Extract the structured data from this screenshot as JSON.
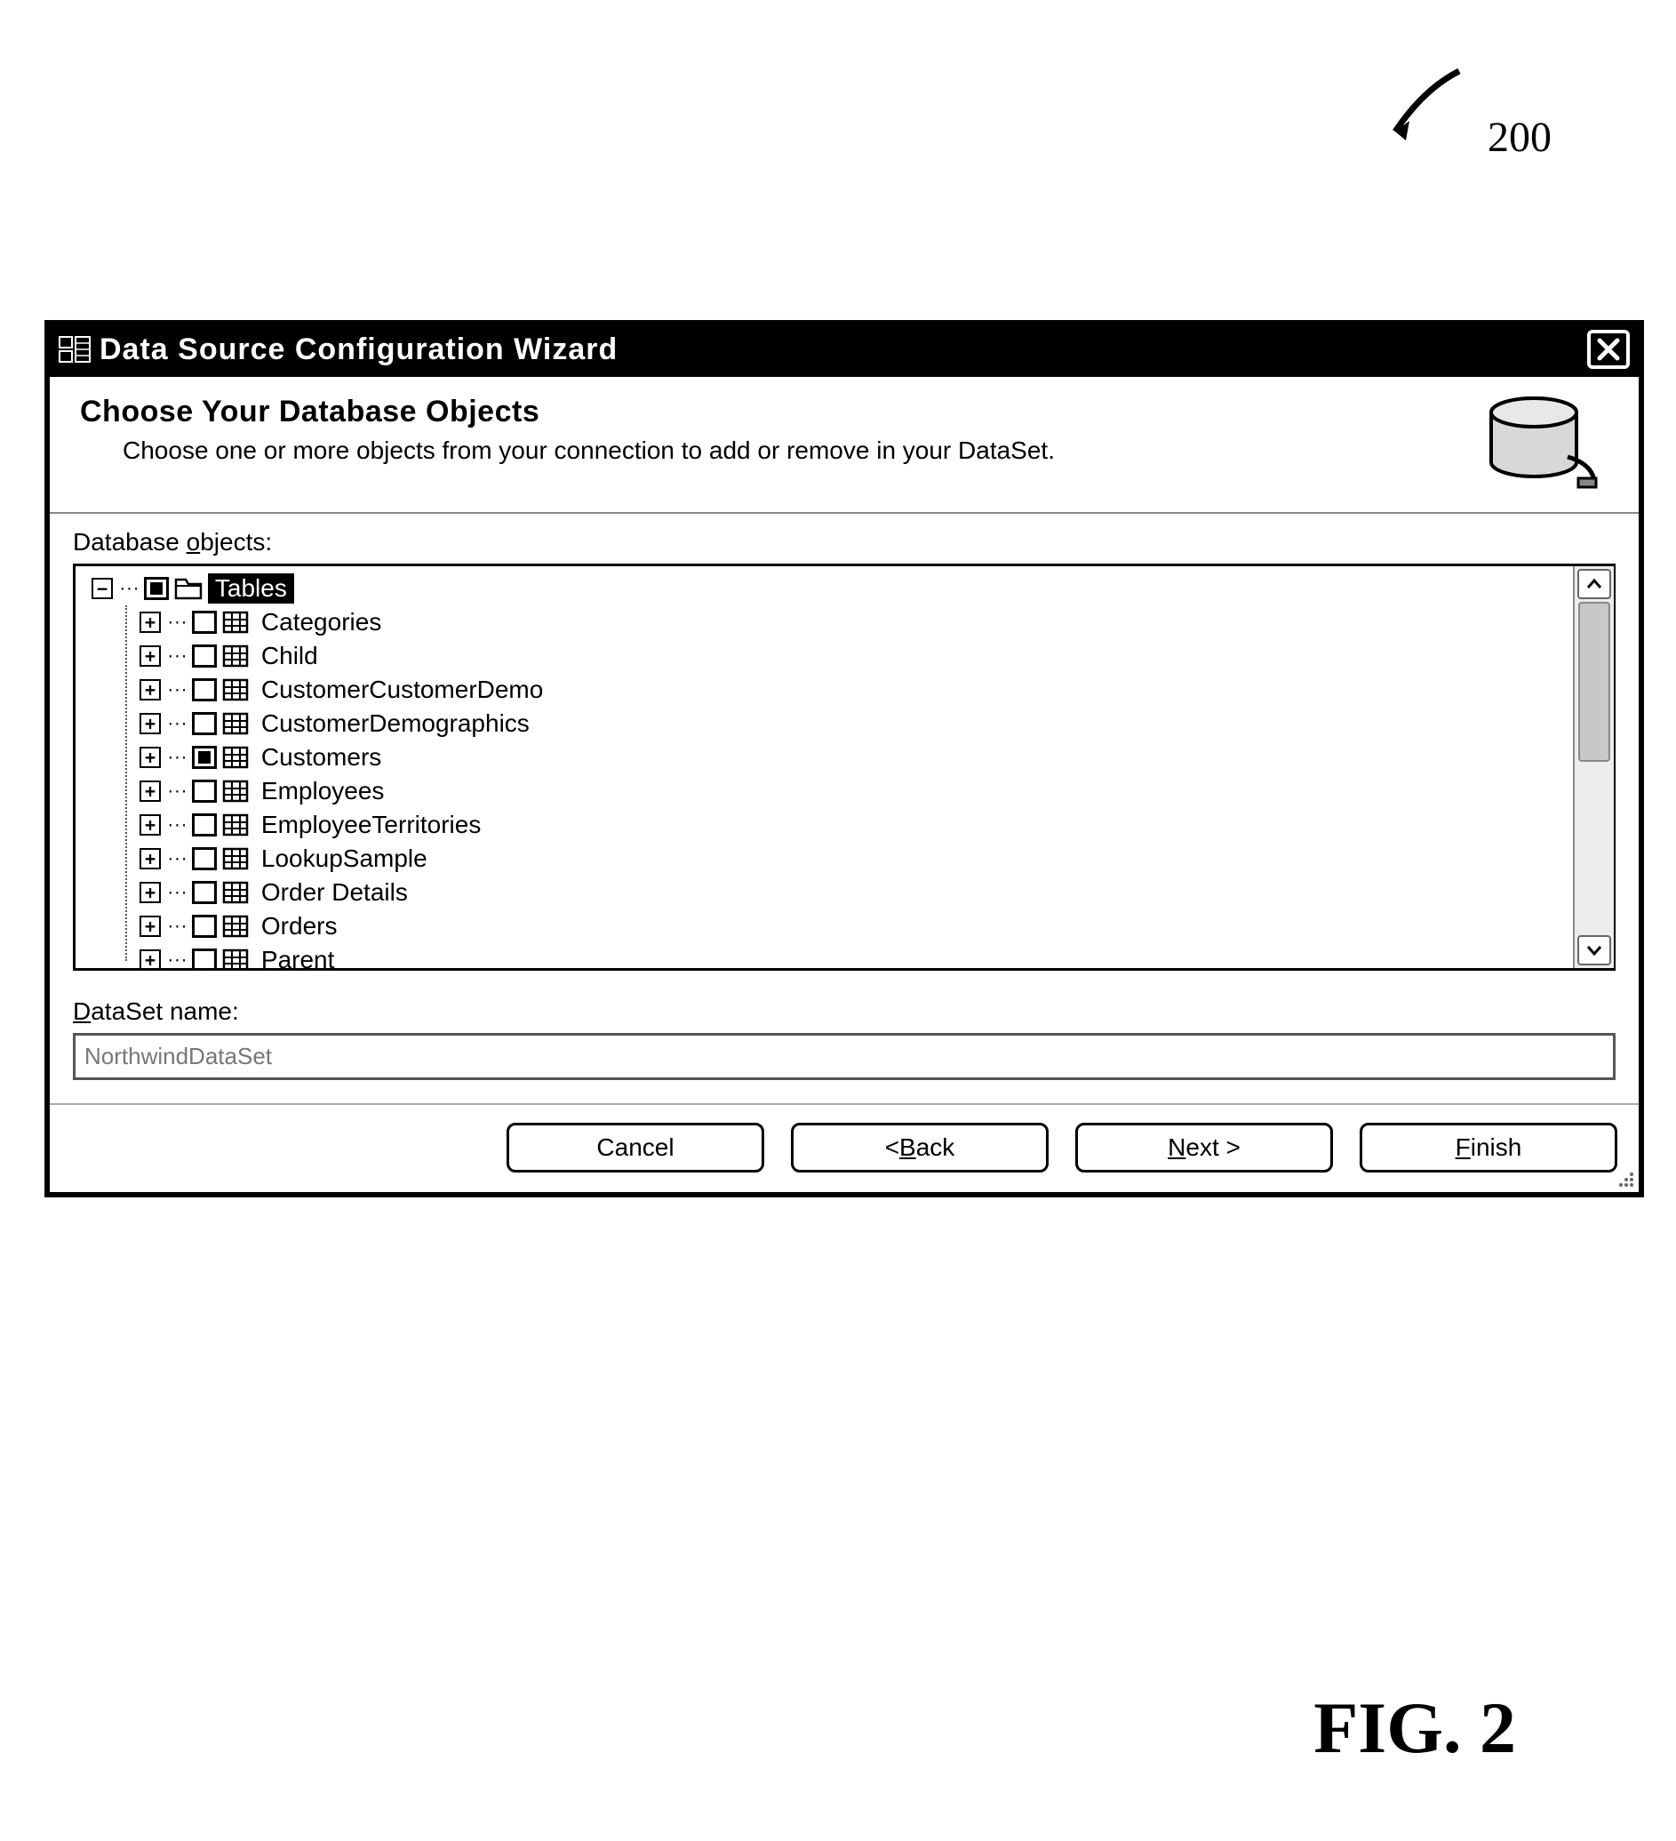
{
  "figure": {
    "top_label": "200",
    "bottom_label": "FIG. 2"
  },
  "window": {
    "title": "Data Source Configuration Wizard"
  },
  "header": {
    "title": "Choose Your Database Objects",
    "subtitle": "Choose one or more objects from your connection to add or remove in your DataSet."
  },
  "tree": {
    "label_prefix": "Database ",
    "label_underline": "o",
    "label_suffix": "bjects:",
    "root": {
      "label": "Tables",
      "expanded": true,
      "checked": "partial",
      "selected": true
    },
    "items": [
      {
        "label": "Categories",
        "checked": false
      },
      {
        "label": "Child",
        "checked": false
      },
      {
        "label": "CustomerCustomerDemo",
        "checked": false
      },
      {
        "label": "CustomerDemographics",
        "checked": false
      },
      {
        "label": "Customers",
        "checked": "partial"
      },
      {
        "label": "Employees",
        "checked": false
      },
      {
        "label": "EmployeeTerritories",
        "checked": false
      },
      {
        "label": "LookupSample",
        "checked": false
      },
      {
        "label": "Order Details",
        "checked": false
      },
      {
        "label": "Orders",
        "checked": false
      },
      {
        "label": "Parent",
        "checked": false
      }
    ]
  },
  "dataset": {
    "label_underline": "D",
    "label_suffix": "ataSet name:",
    "value": "NorthwindDataSet"
  },
  "buttons": {
    "cancel": "Cancel",
    "back_prefix": "< ",
    "back_underline": "B",
    "back_suffix": "ack",
    "next_underline": "N",
    "next_suffix": "ext >",
    "finish_underline": "F",
    "finish_suffix": "inish"
  }
}
